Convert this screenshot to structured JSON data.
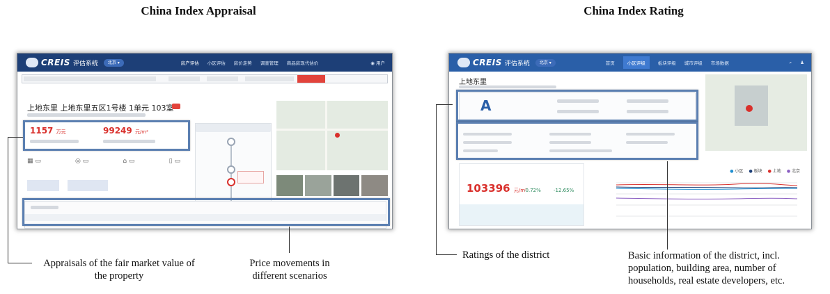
{
  "left_panel": {
    "title": "China Index Appraisal",
    "app": {
      "logo": "CREIS",
      "system_name": "评估系统",
      "nav_items": [
        "房产评估",
        "小区评估",
        "房价走势",
        "调查管理",
        "商品房现代估价"
      ],
      "address": "上地东里 上地东里五区1号楼 1单元 103室",
      "total_value": "1157",
      "total_unit": "万元",
      "unit_price": "99249",
      "unit_price_unit": "元/m²"
    },
    "captions": {
      "fair_value": "Appraisals of the fair market value of the property",
      "price_movements": "Price movements in different scenarios"
    }
  },
  "right_panel": {
    "title": "China Index Rating",
    "app": {
      "logo": "CREIS",
      "system_name": "评估系统",
      "nav_items": [
        "首页",
        "小区评级",
        "板块评级",
        "城市评级",
        "市场数据"
      ],
      "district_name": "上地东里",
      "rating_grade": "A",
      "avg_price": "103396",
      "avg_price_unit": "元/m²",
      "change_mom": "-0.72%",
      "change_yoy": "-12.65%",
      "legend": [
        "小区",
        "板块",
        "上地",
        "北京"
      ]
    },
    "captions": {
      "ratings": "Ratings of the district",
      "basic_info": "Basic information of the district, incl. population, building area, number of households, real estate developers, etc."
    }
  },
  "colors": {
    "nav_bar": "#1d3f77",
    "accent_red": "#d9302c",
    "highlight_box": "#5b7fb1"
  },
  "icons": [
    "logo-mark-icon",
    "search-icon",
    "user-icon",
    "map-pin-icon"
  ]
}
